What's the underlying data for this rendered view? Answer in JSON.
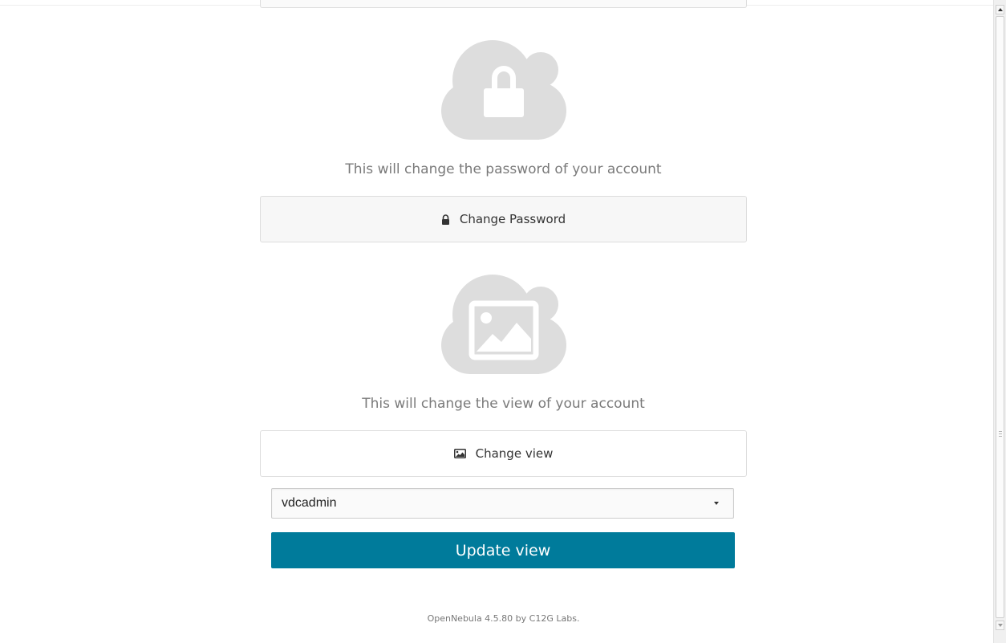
{
  "password_section": {
    "icon": "cloud-lock-icon",
    "description": "This will change the password of your account",
    "button_label": "Change Password",
    "button_icon": "lock-icon"
  },
  "view_section": {
    "icon": "cloud-picture-icon",
    "description": "This will change the view of your account",
    "button_label": "Change view",
    "button_icon": "picture-icon",
    "select_value": "vdcadmin",
    "update_button_label": "Update view"
  },
  "footer": {
    "text": "OpenNebula 4.5.80 by C12G Labs."
  },
  "colors": {
    "primary_button": "#007b9b",
    "cloud_icon": "#dddddd",
    "description_text": "#7a7a7a"
  }
}
